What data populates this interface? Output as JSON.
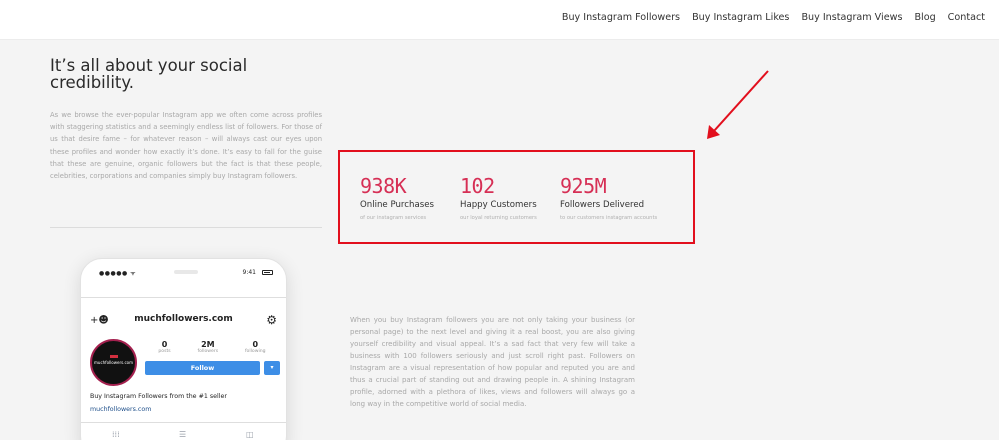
{
  "nav": {
    "items": [
      "Buy Instagram Followers",
      "Buy Instagram Likes",
      "Buy Instagram Views",
      "Blog",
      "Contact"
    ]
  },
  "intro": {
    "headline": "It’s all about your social credibility.",
    "body": "As we browse the ever-popular Instagram app we often come across profiles with staggering statistics and a seemingly endless list of followers. For those of us that desire fame – for whatever reason – will always cast our eyes upon these profiles and wonder how exactly it’s done. It’s easy to fall for the guise that these are genuine, organic followers but the fact is that these people, celebrities, corporations and companies simply buy Instagram followers."
  },
  "stats": [
    {
      "value": "938K",
      "label": "Online Purchases",
      "sub": "of our instagram services"
    },
    {
      "value": "102",
      "label": "Happy Customers",
      "sub": "our loyal returning customers"
    },
    {
      "value": "925M",
      "label": "Followers Delivered",
      "sub": "to our customers instagram accounts"
    }
  ],
  "phone": {
    "signal": "●●●●● ᯤ",
    "time": "9:41",
    "title": "muchfollowers.com",
    "avatar_text": "muchfollowers.com",
    "counts": [
      {
        "num": "0",
        "label": "posts"
      },
      {
        "num": "2M",
        "label": "followers"
      },
      {
        "num": "0",
        "label": "following"
      }
    ],
    "follow_label": "Follow",
    "caret": "▾",
    "bio": "Buy Instagram Followers from the #1 seller",
    "bio_link": "muchfollowers.com"
  },
  "copy": "When you buy Instagram followers you are not only taking your business (or personal page) to the next level and giving it a real boost, you are also giving yourself credibility and visual appeal. It’s a sad fact that very few will take a business with 100 followers seriously and just scroll right past. Followers on Instagram are a visual representation of how popular and reputed you are and thus a crucial part of standing out and drawing people in. A shining Instagram profile, adorned with a plethora of likes, views and followers will always go a long way in the competitive world of social media.",
  "colors": {
    "accent": "#d62f55",
    "highlight": "#e20f1d",
    "button": "#3d8ee6"
  }
}
